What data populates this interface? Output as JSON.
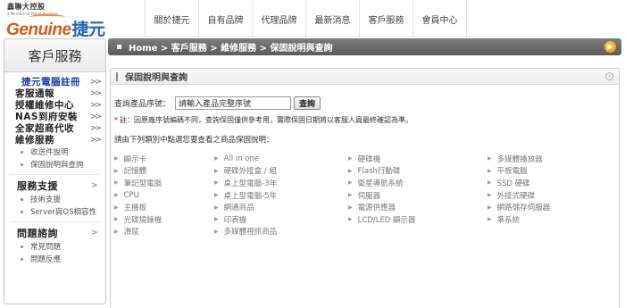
{
  "header": {
    "logo_parent": "鑫聯大控股",
    "logo_tagline": "a Member of Yageo Holdings",
    "logo_brand": "Genuine",
    "logo_brand_cn": "捷元",
    "nav": [
      "關於捷元",
      "自有品牌",
      "代理品牌",
      "最新消息",
      "客戶服務",
      "會員中心"
    ]
  },
  "sidebar": {
    "title": "客戶服務",
    "items": [
      {
        "label": "捷元電腦註冊",
        "arrow": ">>",
        "active": true
      },
      {
        "label": "客服通報",
        "arrow": ">>"
      },
      {
        "label": "授權維修中心",
        "arrow": ">>"
      },
      {
        "label": "NAS到府安裝",
        "arrow": ">>"
      },
      {
        "label": "全家超商代收",
        "arrow": ">>"
      },
      {
        "label": "維修服務",
        "arrow": ">>"
      }
    ],
    "repair_subs": [
      "收送件說明",
      "保固說明與查詢"
    ],
    "support": {
      "title": "服務支援",
      "arrow": ">",
      "subs": [
        "技術支援",
        "Server與OS相容性"
      ]
    },
    "faq": {
      "title": "問題諮詢",
      "arrow": ">",
      "subs": [
        "常見問題",
        "問題反應"
      ]
    }
  },
  "main": {
    "breadcrumb": "Home > 客戶服務 > 維修服務 > 保固說明與查詢",
    "panel_title": "保固說明與查詢",
    "search_label": "查詢產品序號：",
    "search_value": "請輸入產品完整序號",
    "search_button": "查詢",
    "note": "註：因原廠序號編碼不同，查詢保固僅供參考用，實際保固日期將以客服人員最終確認為準。",
    "instruction": "請由下列類別中點選您要查看之商品保固說明：",
    "categories": [
      [
        "顯示卡",
        "記憶體",
        "筆記型電腦",
        "CPU",
        "主機板",
        "光碟燒錄機",
        "滑鼠"
      ],
      [
        "All in one",
        "硬碟外接盒 / 組",
        "桌上型電腦-3年",
        "桌上型電腦-5年",
        "網通商品",
        "印表機",
        "多媒體視訊商品"
      ],
      [
        "硬碟機",
        "Flash行動碟",
        "衛星導航系統",
        "伺服器",
        "電源供應器",
        "LCD/LED 顯示器"
      ],
      [
        "多媒體播放器",
        "平板電腦",
        "SSD 硬碟",
        "外接式硬碟",
        "網路儲存伺服器",
        "準系統"
      ]
    ]
  }
}
